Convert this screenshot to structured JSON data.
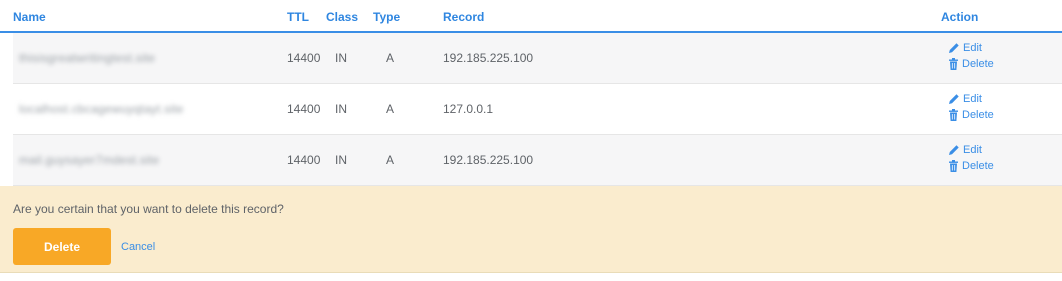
{
  "table": {
    "headers": {
      "name": "Name",
      "ttl": "TTL",
      "class": "Class",
      "type": "Type",
      "record": "Record",
      "action": "Action"
    },
    "rows": [
      {
        "name": "thisisgreatwritingtest.site",
        "ttl": "14400",
        "class": "IN",
        "type": "A",
        "record": "192.185.225.100",
        "edit": "Edit",
        "delete": "Delete"
      },
      {
        "name": "localhost.cbcagewuyqtayt.site",
        "ttl": "14400",
        "class": "IN",
        "type": "A",
        "record": "127.0.0.1",
        "edit": "Edit",
        "delete": "Delete"
      },
      {
        "name": "mail.guysayer7mdest.site",
        "ttl": "14400",
        "class": "IN",
        "type": "A",
        "record": "192.185.225.100",
        "edit": "Edit",
        "delete": "Delete"
      }
    ]
  },
  "confirm": {
    "message": "Are you certain that you want to delete this record?",
    "delete_label": "Delete",
    "cancel_label": "Cancel"
  },
  "colors": {
    "accent": "#2f86e0",
    "warning_bg": "#faecce",
    "delete_button": "#f8a826"
  },
  "icons": {
    "edit": "pencil-icon",
    "delete": "trash-icon"
  }
}
